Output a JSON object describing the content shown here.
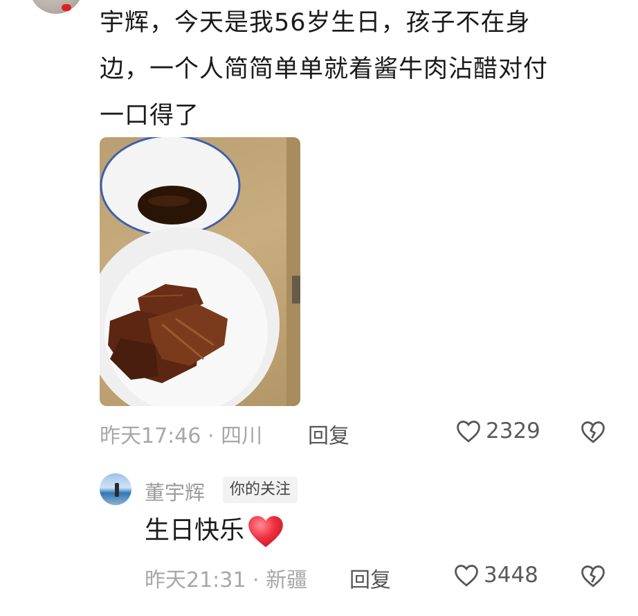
{
  "top_comment": {
    "text_lines": [
      "宇辉，今天是我56岁生日，孩子不在身",
      "边，一个人简简单单就着酱牛肉沾醋对付",
      "一口得了"
    ],
    "time_location": "昨天17:46 · 四川",
    "reply_label": "回复",
    "like_count": "2329"
  },
  "reply_comment": {
    "username": "董宇辉",
    "tag": "你的关注",
    "text": "生日快乐",
    "time_location": "昨天21:31 · 新疆",
    "reply_label": "回复",
    "like_count": "3448"
  },
  "icons": {
    "like": "heart-outline-icon",
    "dislike": "broken-heart-icon",
    "emoji": "red-heart-emoji"
  },
  "colors": {
    "accent_red": "#e8343f",
    "meta_gray": "#a7a7a7"
  }
}
